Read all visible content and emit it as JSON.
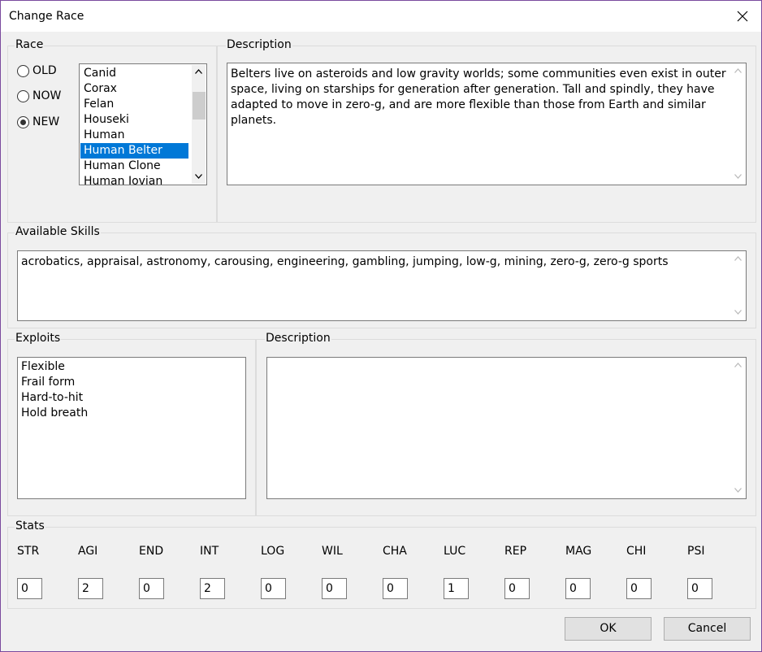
{
  "window": {
    "title": "Change Race"
  },
  "race": {
    "label": "Race",
    "options": [
      {
        "label": "OLD",
        "selected": false
      },
      {
        "label": "NOW",
        "selected": false
      },
      {
        "label": "NEW",
        "selected": true
      }
    ],
    "items": [
      "Canid",
      "Corax",
      "Felan",
      "Houseki",
      "Human",
      "Human Belter",
      "Human Clone",
      "Human Jovian"
    ],
    "selected_item": "Human Belter"
  },
  "race_description": {
    "label": "Description",
    "text": "Belters live on asteroids and low gravity worlds; some communities even exist in outer space, living on starships for generation after generation. Tall and spindly, they have adapted to move in zero-g, and are more flexible than those from Earth and similar planets."
  },
  "skills": {
    "label": "Available Skills",
    "text": "acrobatics, appraisal, astronomy, carousing, engineering, gambling, jumping, low-g, mining, zero-g, zero-g sports"
  },
  "exploits": {
    "label": "Exploits",
    "items": [
      "Flexible",
      "Frail form",
      "Hard-to-hit",
      "Hold breath"
    ]
  },
  "exploit_description": {
    "label": "Description",
    "text": ""
  },
  "stats": {
    "label": "Stats",
    "items": [
      {
        "name": "STR",
        "value": "0"
      },
      {
        "name": "AGI",
        "value": "2"
      },
      {
        "name": "END",
        "value": "0"
      },
      {
        "name": "INT",
        "value": "2"
      },
      {
        "name": "LOG",
        "value": "0"
      },
      {
        "name": "WIL",
        "value": "0"
      },
      {
        "name": "CHA",
        "value": "0"
      },
      {
        "name": "LUC",
        "value": "1"
      },
      {
        "name": "REP",
        "value": "0"
      },
      {
        "name": "MAG",
        "value": "0"
      },
      {
        "name": "CHI",
        "value": "0"
      },
      {
        "name": "PSI",
        "value": "0"
      }
    ]
  },
  "buttons": {
    "ok": "OK",
    "cancel": "Cancel"
  }
}
